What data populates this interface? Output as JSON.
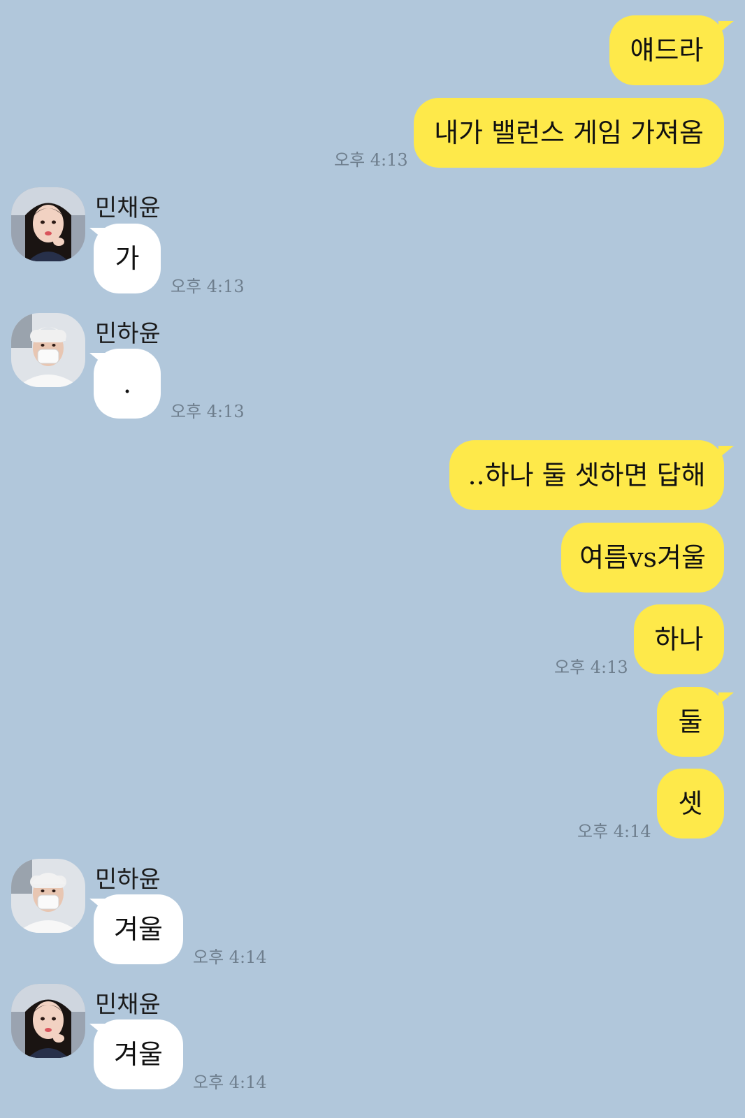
{
  "chat": {
    "messages": [
      {
        "side": "me",
        "text": "얘드라"
      },
      {
        "side": "me",
        "text": "내가 밸런스 게임 가져옴",
        "time": "오후 4:13"
      },
      {
        "side": "other",
        "name": "민채윤",
        "avatar": "chaeyun-avatar",
        "text": "가",
        "time": "오후 4:13"
      },
      {
        "side": "other",
        "name": "민하윤",
        "avatar": "hayun-avatar",
        "text": ".",
        "time": "오후 4:13"
      },
      {
        "side": "me",
        "text": "..하나 둘 셋하면 답해"
      },
      {
        "side": "me",
        "text": "여름vs겨울"
      },
      {
        "side": "me",
        "text": "하나",
        "time": "오후 4:13"
      },
      {
        "side": "me",
        "text": "둘"
      },
      {
        "side": "me",
        "text": "셋",
        "time": "오후 4:14"
      },
      {
        "side": "other",
        "name": "민하윤",
        "avatar": "hayun-avatar",
        "text": "겨울",
        "time": "오후 4:14"
      },
      {
        "side": "other",
        "name": "민채윤",
        "avatar": "chaeyun-avatar",
        "text": "겨울",
        "time": "오후 4:14"
      }
    ]
  },
  "colors": {
    "background": "#b1c7db",
    "my_bubble": "#fee94a",
    "other_bubble": "#ffffff",
    "timestamp": "#6e7e8d"
  }
}
